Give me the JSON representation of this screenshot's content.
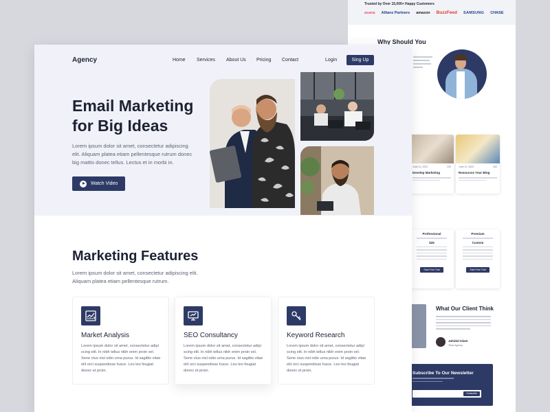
{
  "back_page": {
    "trust_label": "Trusted by Over 15,000+ Happy Customers",
    "logos": [
      "asana",
      "Allianz Partners",
      "amazon",
      "BuzzFeed",
      "SAMSUNG",
      "CHASE"
    ],
    "why_title": "Why Should You Choose Me",
    "blog_cards": [
      {
        "date": "June 11, 2023",
        "count": "220",
        "title": "Develop Marketing"
      },
      {
        "date": "June 11, 2023",
        "count": "240",
        "title": "Resources Your Blog"
      }
    ],
    "plans": [
      {
        "name": "Professional",
        "price": "$25",
        "button": "Start Free Trial"
      },
      {
        "name": "Premium",
        "price": "Custom",
        "button": "Start Free Trial"
      }
    ],
    "client_title": "What Our Client Think",
    "client_name": "Jahidul Islam",
    "client_role": "Team Agency",
    "newsletter_title": "Subscribe To Our Newsletter",
    "newsletter_button": "Subscribe"
  },
  "header": {
    "logo": "Agency",
    "nav": [
      "Home",
      "Services",
      "About Us",
      "Pricing",
      "Contact"
    ],
    "login": "Login",
    "signup": "Sing Up"
  },
  "hero": {
    "title": "Email Marketing for Big Ideas",
    "description": "Lorem ipsum dolor sit amet, consectetur adipiscing elit. Aliquam platea etiam pellentesque rutrum donec big mattis donec tellus. Lectus et in morbi in.",
    "cta": "Watch Video"
  },
  "features": {
    "title": "Marketing Features",
    "description": "Lorem ipsum dolor sit amet, consectetur adipiscing elit. Aliquam platea etiam pellentesque rutrum.",
    "cards": [
      {
        "icon": "chart-icon",
        "title": "Market Analysis",
        "text": "Lorem ipsum dolor sit amet, consectetur adipi scing elit. In nibh tellus nibh enim proin vel. Sene ctus nisl odio urna purus. Id sagittis vitae elit orci suspendisse fusce. Leo leo feugiat donec et proin."
      },
      {
        "icon": "presentation-icon",
        "title": "SEO Consultancy",
        "text": "Lorem ipsum dolor sit amet, consectetur adipi scing elit. In nibh tellus nibh enim proin vel. Sene ctus nisl odio urna purus. Id sagittis vitae elit orci suspendisse fusce. Leo leo feugiat donec et proin."
      },
      {
        "icon": "key-icon",
        "title": "Keyword Research",
        "text": "Lorem ipsum dolor sit amet, consectetur adipi scing elit. In nibh tellus nibh enim proin vel. Sene ctus nisl odio urna purus. Id sagittis vitae elit orci suspendisse fusce. Leo leo feugiat donec et proin."
      }
    ]
  },
  "colors": {
    "primary": "#2e3a66",
    "hero_bg": "#f1f2f9",
    "page_bg": "#d6d8de"
  }
}
